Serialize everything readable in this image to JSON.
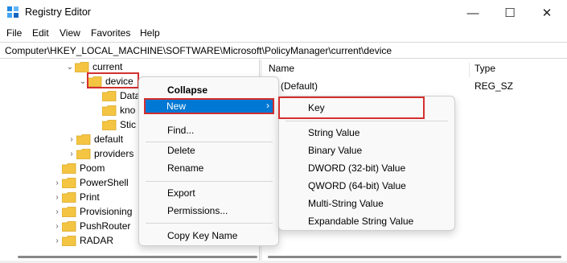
{
  "window": {
    "title": "Registry Editor",
    "minimize": "—",
    "maximize": "☐",
    "close": "✕"
  },
  "menu": {
    "file": "File",
    "edit": "Edit",
    "view": "View",
    "favorites": "Favorites",
    "help": "Help"
  },
  "address": "Computer\\HKEY_LOCAL_MACHINE\\SOFTWARE\\Microsoft\\PolicyManager\\current\\device",
  "tree": {
    "current": "current",
    "device": "device",
    "child1": "Data",
    "child2": "kno",
    "child3": "Stic",
    "default": "default",
    "providers": "providers",
    "poom": "Poom",
    "powershell": "PowerShell",
    "print": "Print",
    "provisioning": "Provisioning",
    "pushrouter": "PushRouter",
    "radar": "RADAR"
  },
  "list": {
    "col_name": "Name",
    "col_type": "Type",
    "row_name": "(Default)",
    "row_type": "REG_SZ"
  },
  "context_menu": {
    "collapse": "Collapse",
    "new": "New",
    "find": "Find...",
    "delete": "Delete",
    "rename": "Rename",
    "export": "Export",
    "permissions": "Permissions...",
    "copy_key_name": "Copy Key Name"
  },
  "submenu": {
    "key": "Key",
    "string": "String Value",
    "binary": "Binary Value",
    "dword": "DWORD (32-bit) Value",
    "qword": "QWORD (64-bit) Value",
    "multi": "Multi-String Value",
    "expandable": "Expandable String Value"
  },
  "colors": {
    "highlight": "#0078d4",
    "annotation": "#d32f2f",
    "folder": "#f4c542"
  }
}
